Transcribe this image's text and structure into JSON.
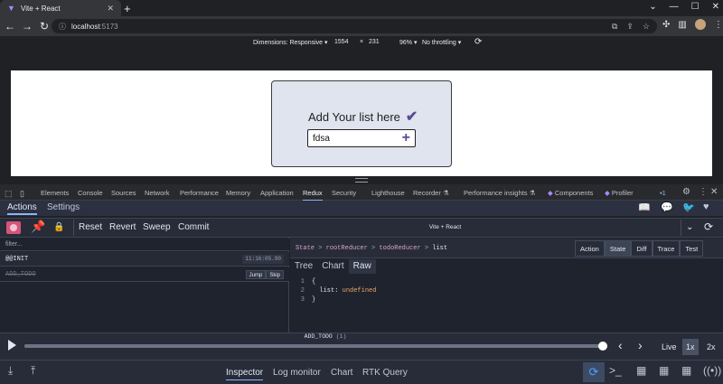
{
  "browser": {
    "tab_title": "Vite + React",
    "tab_favicon": "vite-icon",
    "url_host": "localhost",
    "url_port": ":5173"
  },
  "device_toolbar": {
    "dimensions_label": "Dimensions: Responsive",
    "width": "1554",
    "times": "×",
    "height": "231",
    "zoom": "96%",
    "throttling": "No throttling"
  },
  "app": {
    "title": "Add Your list here",
    "check_icon": "✔",
    "input_value": "fdsa",
    "add_icon": "+"
  },
  "devtools_tabs": [
    "Elements",
    "Console",
    "Sources",
    "Network",
    "Performance",
    "Memory",
    "Application",
    "Redux",
    "Security",
    "Lighthouse",
    "Recorder",
    "Performance insights",
    "Components",
    "Profiler"
  ],
  "devtools_active_tab": "Redux",
  "devtools_badge": "1",
  "redux": {
    "header_tabs": {
      "actions": "Actions",
      "settings": "Settings"
    },
    "toolbar": {
      "reset": "Reset",
      "revert": "Revert",
      "sweep": "Sweep",
      "commit": "Commit",
      "instance": "Vite + React"
    },
    "filter_placeholder": "filter...",
    "actions": [
      {
        "name": "@@INIT",
        "time": "11:16:05.90"
      },
      {
        "name": "ADD_TODO",
        "jump": "Jump",
        "skip": "Skip"
      }
    ],
    "breadcrumb": {
      "state": "State",
      "root": "rootReducer",
      "todo": "todoReducer",
      "sep": ">",
      "current": "list"
    },
    "monitor_tabs": [
      "Action",
      "State",
      "Diff",
      "Trace",
      "Test"
    ],
    "monitor_active": "State",
    "sub_tabs": [
      "Tree",
      "Chart",
      "Raw"
    ],
    "sub_active": "Raw",
    "raw_code": [
      {
        "line": "1",
        "text": "{"
      },
      {
        "line": "2",
        "key": "list:",
        "value": "undefined"
      },
      {
        "line": "3",
        "text": "}"
      }
    ],
    "slider": {
      "action": "ADD_TODO",
      "count": "(1)",
      "live": "Live",
      "speed_1x": "1x",
      "speed_2x": "2x",
      "position": 1.0
    },
    "bottom_tabs": {
      "inspector": "Inspector",
      "log_monitor": "Log monitor",
      "chart": "Chart",
      "rtk_query": "RTK Query"
    }
  },
  "colors": {
    "record": "#d4557a",
    "accent": "#5c4b94",
    "devtools_bg": "#202124",
    "redux_bg": "#1f232d"
  }
}
